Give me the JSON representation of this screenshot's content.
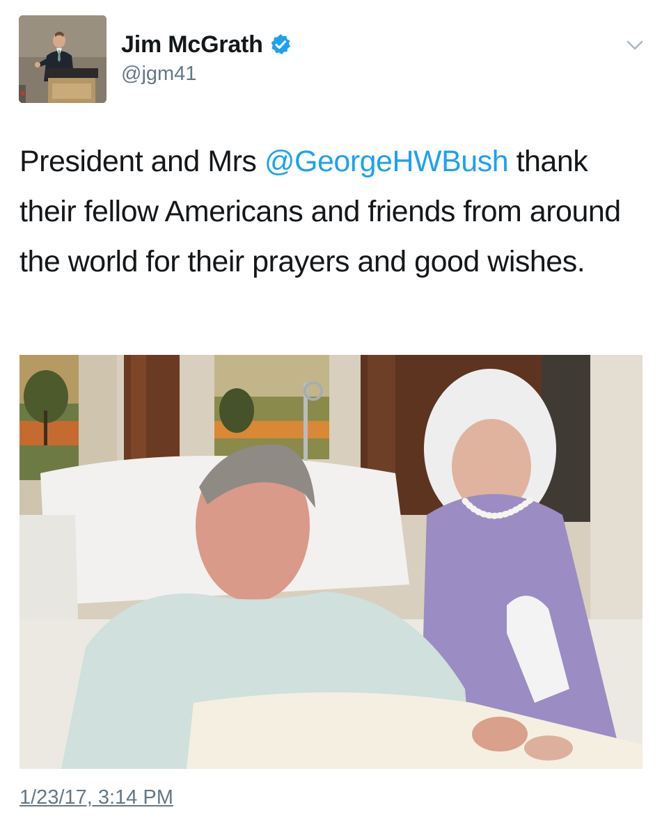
{
  "author": {
    "display_name": "Jim McGrath",
    "handle": "@jgm41",
    "verified": true
  },
  "icons": {
    "verified": "verified-badge-icon",
    "menu": "chevron-down-icon"
  },
  "tweet": {
    "text_prefix": "President and Mrs ",
    "mention": "@GeorgeHWBush",
    "text_suffix": " thank their fellow Americans and friends from around the world for their prayers and good wishes.",
    "timestamp": "1/23/17, 3:14 PM"
  },
  "colors": {
    "link": "#1da1f2",
    "verified": "#1da1f2",
    "secondary_text": "#657786"
  }
}
